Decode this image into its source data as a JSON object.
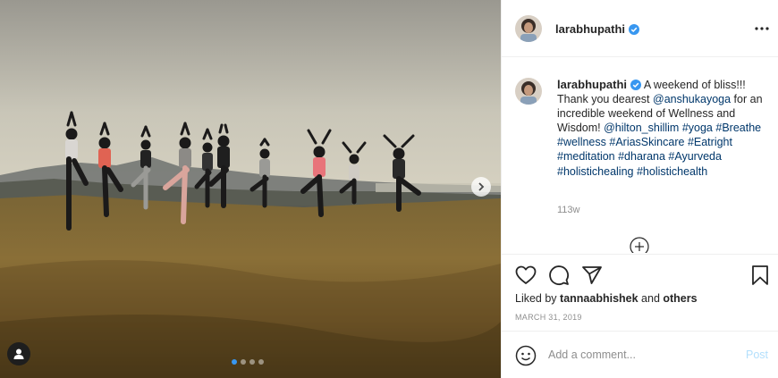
{
  "post": {
    "username": "larabhupathi",
    "verified": true,
    "image_alt_icon": "photo",
    "carousel": {
      "count": 4,
      "active_index": 0
    }
  },
  "caption": {
    "username": "larabhupathi",
    "segments": [
      {
        "text": "A weekend of bliss!!! Thank you dearest ",
        "link": false
      },
      {
        "text": "@anshukayoga",
        "link": true
      },
      {
        "text": " for an incredible weekend of Wellness and Wisdom! ",
        "link": false
      },
      {
        "text": "@hilton_shillim",
        "link": true
      },
      {
        "text": " ",
        "link": false
      },
      {
        "text": "#yoga",
        "link": true
      },
      {
        "text": " ",
        "link": false
      },
      {
        "text": "#Breathe",
        "link": true
      },
      {
        "text": " ",
        "link": false
      },
      {
        "text": "#wellness",
        "link": true
      },
      {
        "text": " ",
        "link": false
      },
      {
        "text": "#AriasSkincare",
        "link": true
      },
      {
        "text": " ",
        "link": false
      },
      {
        "text": "#Eatright",
        "link": true
      },
      {
        "text": " ",
        "link": false
      },
      {
        "text": "#meditation",
        "link": true
      },
      {
        "text": " ",
        "link": false
      },
      {
        "text": "#dharana",
        "link": true
      },
      {
        "text": " ",
        "link": false
      },
      {
        "text": "#Ayurveda",
        "link": true
      },
      {
        "text": " ",
        "link": false
      },
      {
        "text": "#holistichealing",
        "link": true
      },
      {
        "text": " ",
        "link": false
      },
      {
        "text": "#holistichealth",
        "link": true
      }
    ],
    "age": "113w"
  },
  "likes": {
    "prefix": "Liked by ",
    "user": "tannaabhishek",
    "middle": " and ",
    "others": "others"
  },
  "date": "MARCH 31, 2019",
  "comment_box": {
    "placeholder": "Add a comment...",
    "post_label": "Post"
  },
  "colors": {
    "link": "#00376b",
    "verified": "#3897f0",
    "post_disabled": "#b2dffc",
    "muted": "#8e8e8e"
  },
  "icons": [
    "more-icon",
    "heart-icon",
    "comment-icon",
    "share-icon",
    "bookmark-icon",
    "emoji-icon",
    "load-more-icon",
    "user-tag-icon",
    "chevron-right-icon",
    "verified-icon"
  ]
}
